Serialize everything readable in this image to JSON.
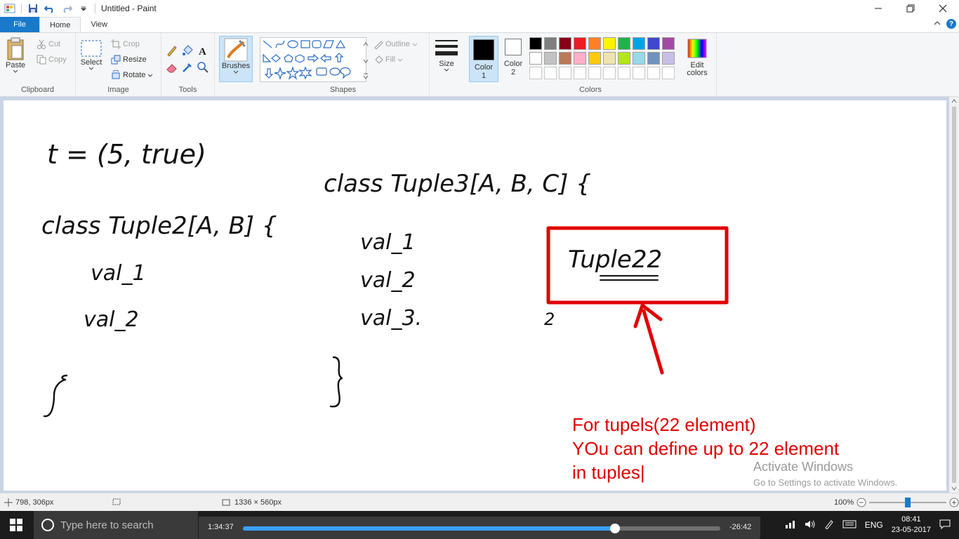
{
  "window": {
    "title": "Untitled - Paint"
  },
  "tabs": [
    {
      "label": "File"
    },
    {
      "label": "Home"
    },
    {
      "label": "View"
    }
  ],
  "ribbon": {
    "clipboard": {
      "label": "Clipboard",
      "paste": "Paste",
      "cut": "Cut",
      "copy": "Copy"
    },
    "image": {
      "label": "Image",
      "select": "Select",
      "crop": "Crop",
      "resize": "Resize",
      "rotate": "Rotate"
    },
    "tools": {
      "label": "Tools"
    },
    "brushes": {
      "label": "Brushes"
    },
    "shapes": {
      "label": "Shapes",
      "outline": "Outline",
      "fill": "Fill"
    },
    "size": {
      "label": "Size"
    },
    "color1": {
      "label": "Color",
      "num": "1"
    },
    "color2": {
      "label": "Color",
      "num": "2"
    },
    "colors": {
      "label": "Colors",
      "edit_label": "Edit",
      "edit_label2": "colors",
      "row1": [
        "#000000",
        "#7f7f7f",
        "#880015",
        "#ed1c24",
        "#ff7f27",
        "#fff200",
        "#22b14c",
        "#00a2e8",
        "#3f48cc",
        "#a349a4"
      ],
      "row2": [
        "#ffffff",
        "#c3c3c3",
        "#b97a57",
        "#ffaec9",
        "#ffc90e",
        "#efe4b0",
        "#b5e61d",
        "#99d9ea",
        "#7092be",
        "#c8bfe7"
      ]
    }
  },
  "canvas": {
    "annotation": {
      "line1": "For tupels(22 element)",
      "line2": "YOu can define up to 22 element",
      "line3": "in tuples|"
    },
    "handwriting": {
      "t_line": "t = (5, true)",
      "class2": "class Tuple2[A, B] {",
      "val1": "val_1",
      "val2": "val_2",
      "class3": "class Tuple3[A, B, C] {",
      "val3_1": "val_1",
      "val3_2": "val_2",
      "val3_3": "val_3.",
      "tuple22": "Tuple22",
      "two": "2"
    },
    "watermark": {
      "title": "Activate Windows",
      "subtitle": "Go to Settings to activate Windows."
    }
  },
  "status": {
    "cursor": "798, 306px",
    "size": "1336 × 560px",
    "zoom": "100%",
    "zoom_level": 0.5
  },
  "taskbar": {
    "search_placeholder": "Type here to search",
    "player_elapsed": "1:34:37",
    "player_remaining": "-26:42",
    "player_progress": 0.78,
    "language": "ENG",
    "time": "08:41",
    "date": "23-05-2017"
  },
  "accent": "#1979ca",
  "annotation_color": "#e00000"
}
